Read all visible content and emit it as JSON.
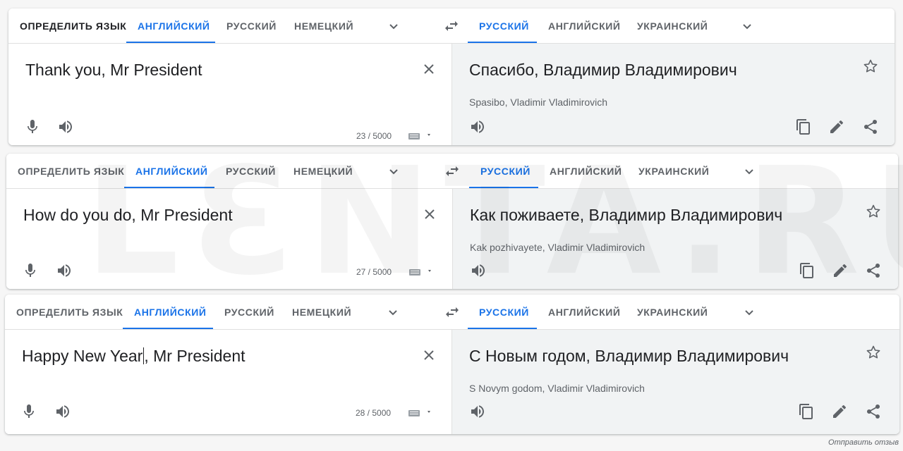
{
  "panels": [
    {
      "source_tabs": [
        "ОПРЕДЕЛИТЬ ЯЗЫК",
        "АНГЛИЙСКИЙ",
        "РУССКИЙ",
        "НЕМЕЦКИЙ"
      ],
      "source_active": 1,
      "target_tabs": [
        "РУССКИЙ",
        "АНГЛИЙСКИЙ",
        "УКРАИНСКИЙ"
      ],
      "target_active": 0,
      "source_text": "Thank you, Mr President",
      "translation": "Спасибо, Владимир Владимирович",
      "transliteration": "Spasibo, Vladimir Vladimirovich",
      "char_count": "23 / 5000"
    },
    {
      "source_tabs": [
        "ОПРЕДЕЛИТЬ ЯЗЫК",
        "АНГЛИЙСКИЙ",
        "РУССКИЙ",
        "НЕМЕЦКИЙ"
      ],
      "source_active": 1,
      "target_tabs": [
        "РУССКИЙ",
        "АНГЛИЙСКИЙ",
        "УКРАИНСКИЙ"
      ],
      "target_active": 0,
      "source_text": "How do you do, Mr President",
      "translation": "Как поживаете, Владимир Владимирович",
      "transliteration": "Kak pozhivayete, Vladimir Vladimirovich",
      "char_count": "27 / 5000"
    },
    {
      "source_tabs": [
        "ОПРЕДЕЛИТЬ ЯЗЫК",
        "АНГЛИЙСКИЙ",
        "РУССКИЙ",
        "НЕМЕЦКИЙ"
      ],
      "source_active": 1,
      "target_tabs": [
        "РУССКИЙ",
        "АНГЛИЙСКИЙ",
        "УКРАИНСКИЙ"
      ],
      "target_active": 0,
      "source_text_before_caret": "Happy New Year",
      "source_text_after_caret": ", Mr President",
      "translation": "С Новым годом, Владимир Владимирович",
      "transliteration": "S Novym godom, Vladimir Vladimirovich",
      "char_count": "28 / 5000"
    }
  ],
  "watermark": "LƐNTA.RU",
  "feedback_link": "Отправить отзыв",
  "colors": {
    "accent": "#1a73e8",
    "target_bg": "#f1f3f4",
    "icon": "#5f6368"
  }
}
